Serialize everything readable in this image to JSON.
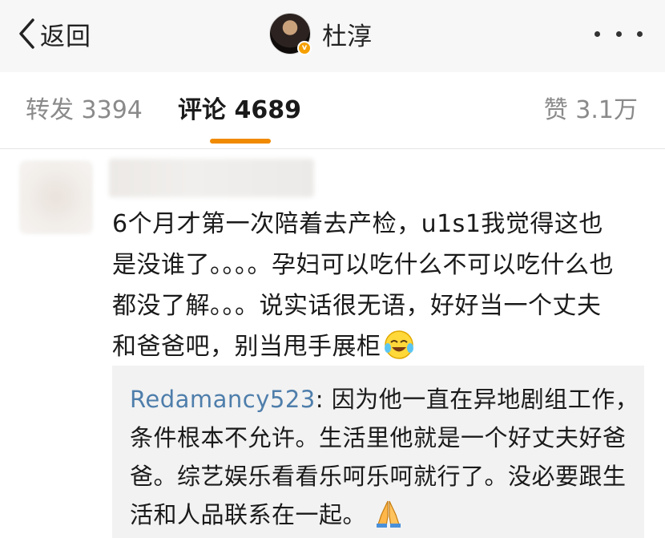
{
  "navbar": {
    "back_label": "返回",
    "username": "杜淳",
    "verified_badge": "v"
  },
  "tabs": {
    "repost": "转发 3394",
    "comments": "评论 4689",
    "likes": "赞 3.1万",
    "active": "comments",
    "indicator_color": "#f08a00"
  },
  "comment": {
    "text": "6个月才第一次陪着去产检，u1s1我觉得这也是没谁了。。。。孕妇可以吃什么不可以吃什么也都没了解。。。说实话很无语，好好当一个丈夫和爸爸吧，别当甩手展柜",
    "emoji": "laughing-crying-emoji"
  },
  "reply": {
    "username": "Redamancy523",
    "separator": ": ",
    "text": "因为他一直在异地剧组工作，条件根本不允许。生活里他就是一个好丈夫好爸爸。综艺娱乐看看乐呵乐呵就行了。没必要跟生活和人品联系在一起。",
    "emoji": "folded-hands-emoji",
    "username_color": "#4e7eab"
  }
}
